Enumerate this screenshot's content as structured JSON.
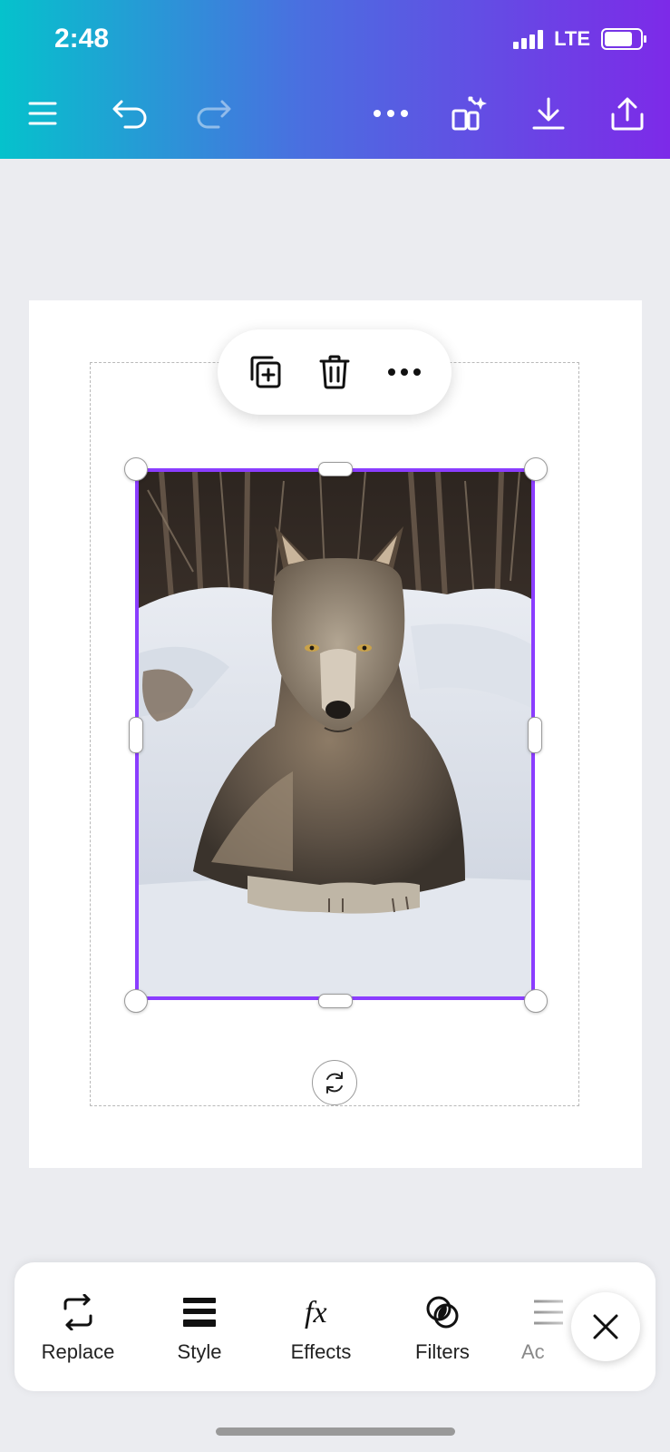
{
  "status_bar": {
    "time": "2:48",
    "network": "LTE"
  },
  "top_toolbar": {
    "icons": [
      "menu-icon",
      "undo-icon",
      "redo-icon",
      "more-options-icon",
      "magic-resize-icon",
      "download-icon",
      "share-icon"
    ],
    "redo_enabled": false
  },
  "canvas": {
    "image_subject": "Gray wolf lying in snow in a forest",
    "selection_color": "#8b3dff"
  },
  "context_toolbar": {
    "icons": [
      "duplicate-icon",
      "delete-icon",
      "more-options-icon"
    ]
  },
  "bottom_tools": {
    "items": [
      {
        "label": "Replace",
        "icon": "replace-icon"
      },
      {
        "label": "Style",
        "icon": "style-icon"
      },
      {
        "label": "Effects",
        "icon": "effects-icon"
      },
      {
        "label": "Filters",
        "icon": "filters-icon"
      },
      {
        "label": "Ac",
        "icon": "adjust-icon"
      }
    ]
  },
  "theme": {
    "gradient_start": "#05c2cc",
    "gradient_end": "#7d2ae8",
    "accent": "#8b3dff"
  }
}
